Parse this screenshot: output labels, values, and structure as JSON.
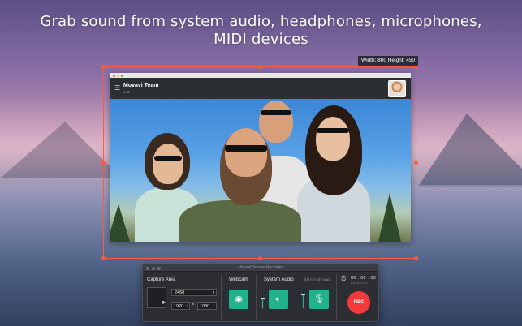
{
  "headline": {
    "line1": "Grab sound from system audio, headphones, microphones,",
    "line2": "MIDI devices"
  },
  "capture_frame": {
    "dimensions_label": "Width: 800  Height: 450",
    "accent_color": "#ff5a3c"
  },
  "app_window": {
    "menu_icon": "hamburger-icon",
    "title": "Movavi Team",
    "subtitle": "4:86",
    "avatar_icon": "user-avatar"
  },
  "recorder": {
    "window_title": "Movavi Screen Recorder",
    "capture_area": {
      "label": "Capture Area",
      "preset": "2460",
      "width": "1920",
      "height": "1080",
      "times_symbol": "×"
    },
    "webcam": {
      "label": "Webcam",
      "icon": "webcam-icon"
    },
    "system_audio": {
      "label": "System Audio",
      "icon": "speaker-icon",
      "level": 0.55
    },
    "microphone": {
      "label": "Microphone",
      "dropdown_caret": "⌄",
      "icon": "microphone-icon",
      "level": 0.8
    },
    "timer": {
      "icon": "alarm-clock-icon",
      "value": "00 : 00 : 00",
      "units": "HR   MIN   SEC"
    },
    "rec_button": {
      "label": "REC",
      "color": "#f23a3a"
    },
    "accent_color": "#20b38b"
  }
}
